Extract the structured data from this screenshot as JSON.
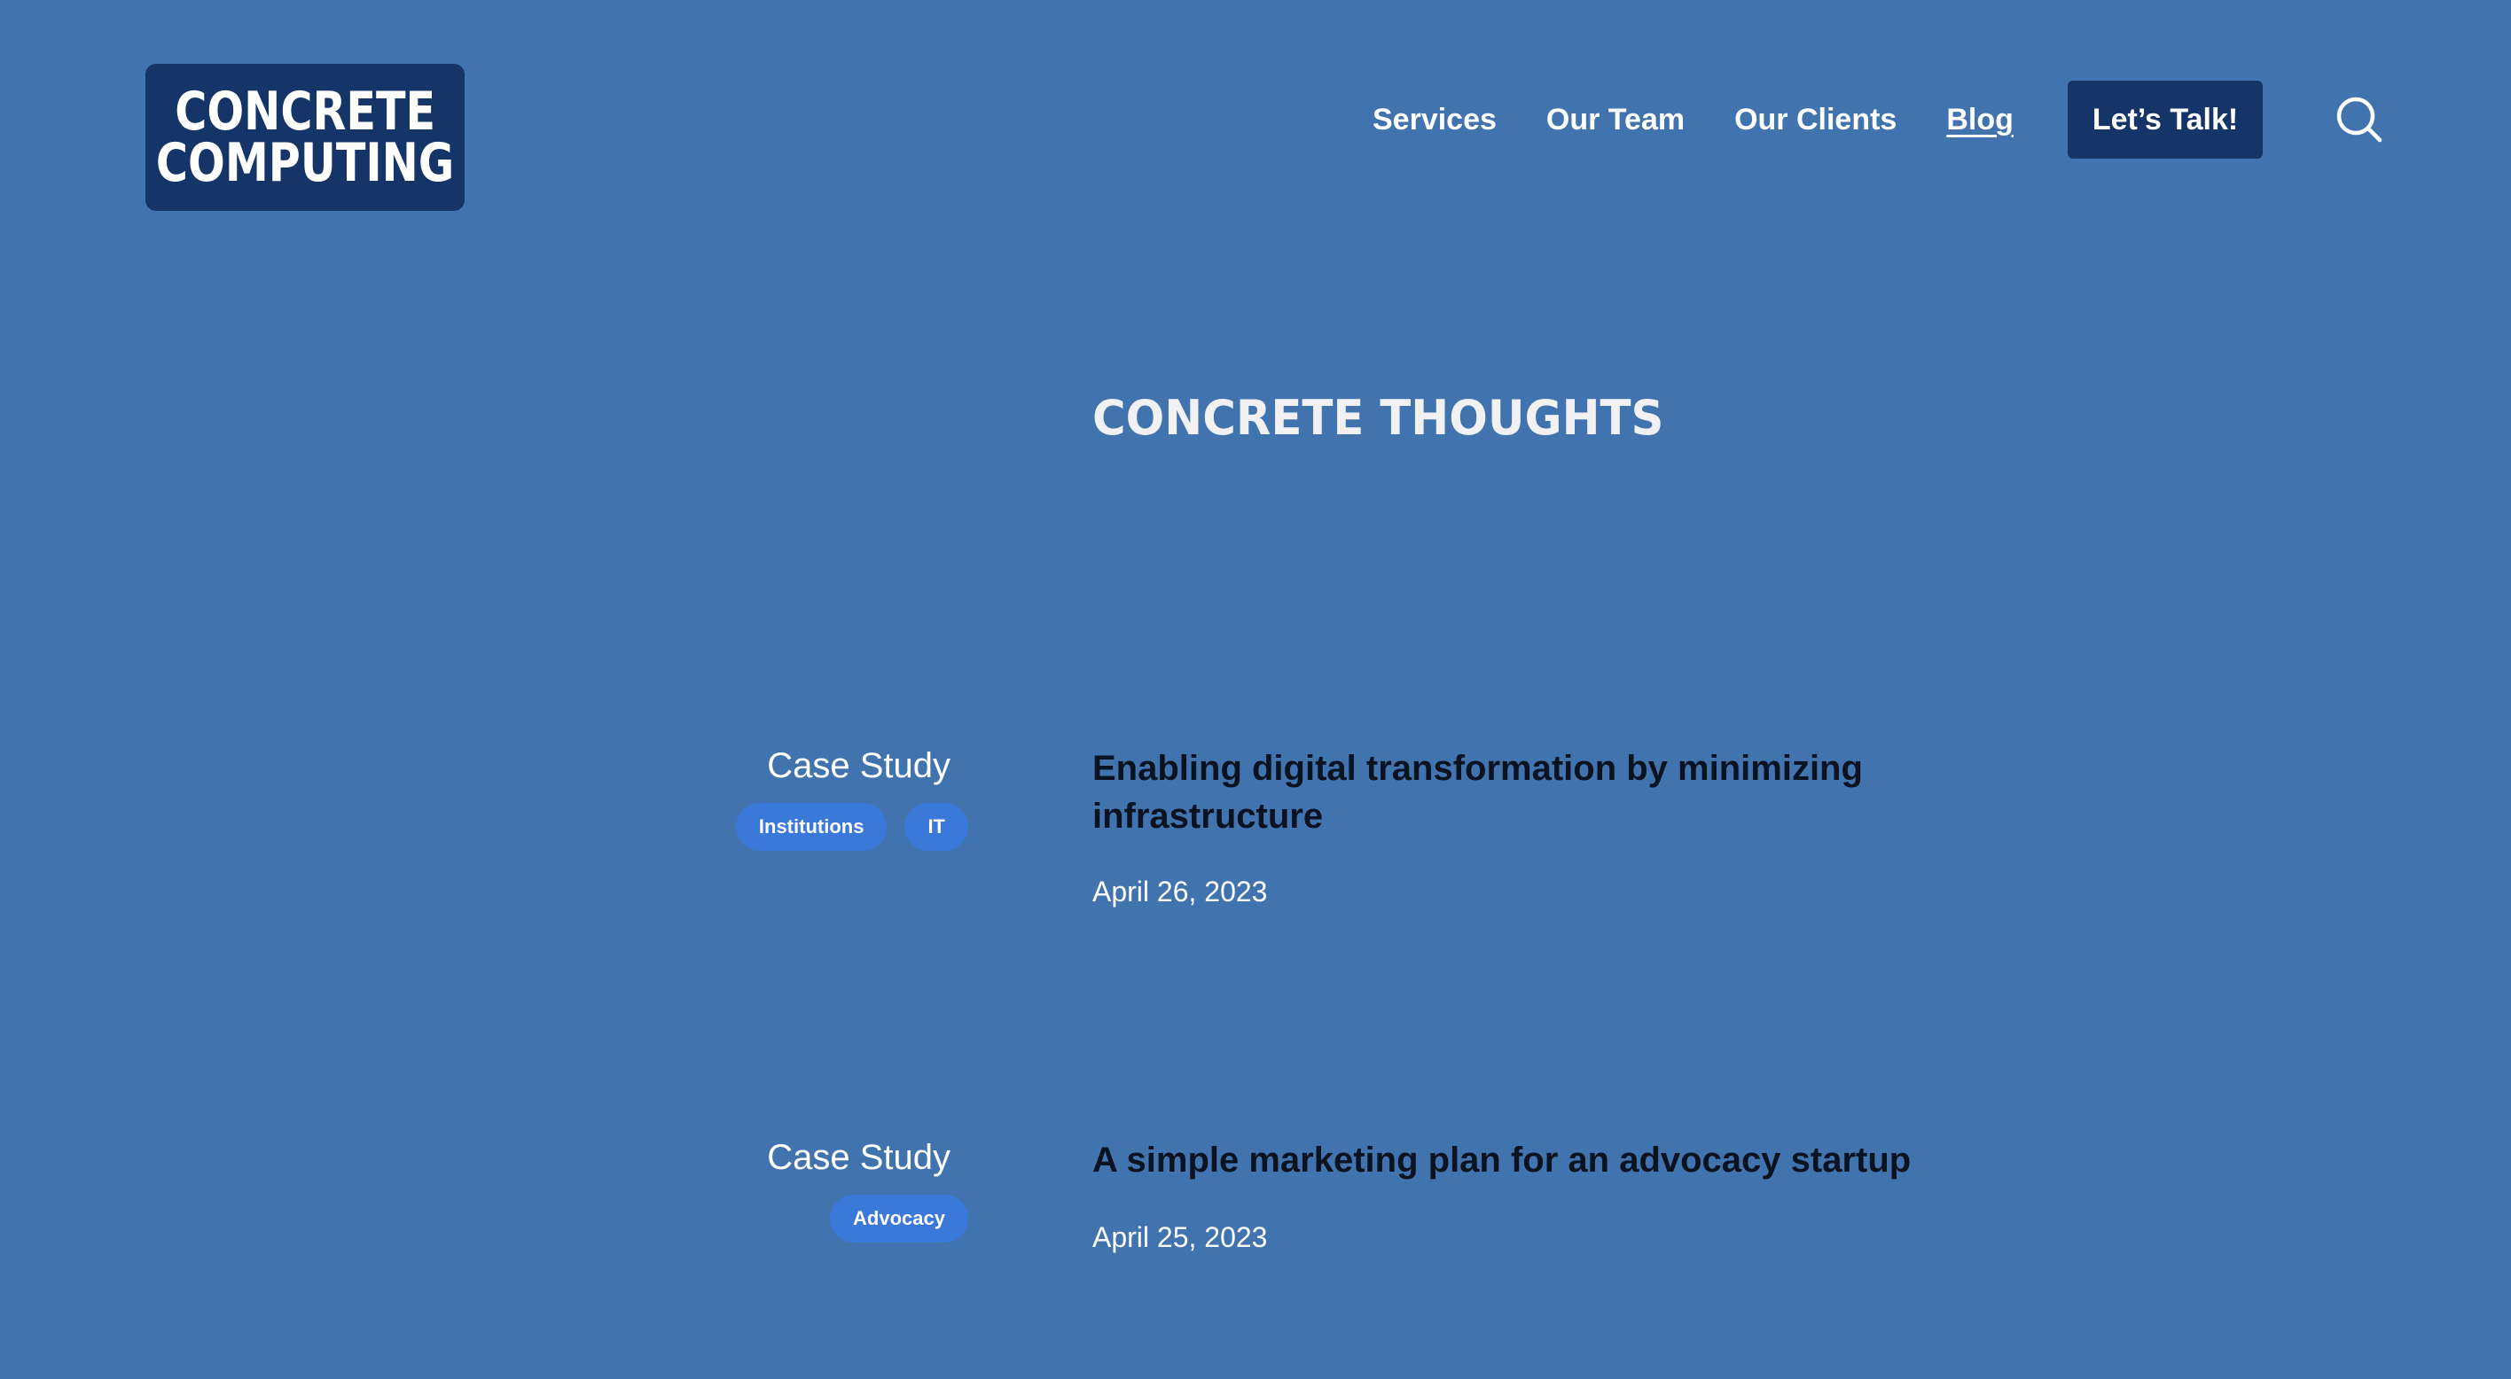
{
  "header": {
    "logo_line1": "CONCRETE",
    "logo_line2": "COMPUTING",
    "nav": [
      "Services",
      "Our Team",
      "Our Clients",
      "Blog"
    ],
    "active_nav": "Blog",
    "cta_label": "Let’s Talk!",
    "search_icon": "search-icon"
  },
  "main": {
    "title": "CONCRETE THOUGHTS",
    "posts": [
      {
        "category": "Case Study",
        "tags": [
          "Institutions",
          "IT"
        ],
        "title": "Enabling digital transformation by minimizing infrastructure",
        "date": "April 26, 2023"
      },
      {
        "category": "Case Study",
        "tags": [
          "Advocacy"
        ],
        "title": "A simple marketing plan for an advocacy startup",
        "date": "April 25, 2023"
      }
    ]
  },
  "colors": {
    "background": "#4174af",
    "navy": "#153468",
    "tag": "#3a78d9",
    "title_text": "#0b1220"
  }
}
